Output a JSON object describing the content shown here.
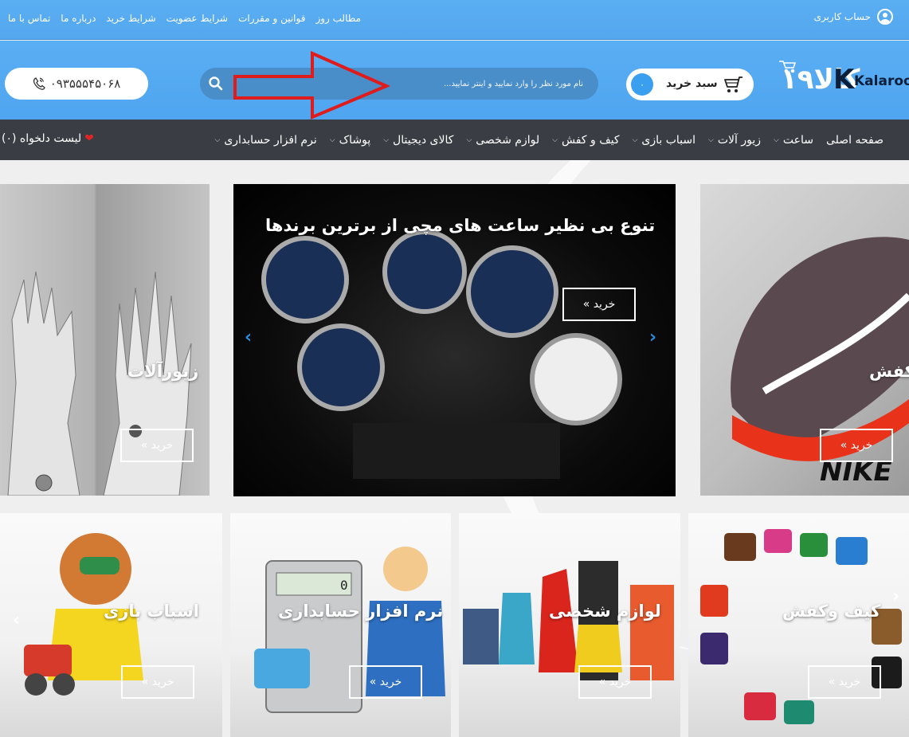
{
  "topbar": {
    "links": [
      "تماس با ما",
      "درباره ما",
      "شرایط خرید",
      "شرایط عضویت",
      "قوانین و مقررات",
      "مطالب روز"
    ],
    "account_label": "حساب کاربری"
  },
  "header": {
    "logo_text": "Kalarooz",
    "cart_label": "سبد خرید",
    "cart_count": "۰",
    "search_placeholder": "نام مورد نظر را وارد نمایید و اینتر نمایید...",
    "phone": "۰۹۳۵۵۵۴۵۰۶۸"
  },
  "nav": {
    "items": [
      {
        "label": "صفحه اصلی",
        "dropdown": false
      },
      {
        "label": "ساعت",
        "dropdown": true
      },
      {
        "label": "زیور آلات",
        "dropdown": true
      },
      {
        "label": "اسباب بازی",
        "dropdown": true
      },
      {
        "label": "کیف و کفش",
        "dropdown": true
      },
      {
        "label": "لوازم شخصی",
        "dropdown": true
      },
      {
        "label": "کالای دیجیتال",
        "dropdown": true
      },
      {
        "label": "پوشاک",
        "dropdown": true
      },
      {
        "label": "نرم افزار حسابداری",
        "dropdown": true
      }
    ],
    "wishlist_label": "لیست دلخواه (۰)"
  },
  "tiles": {
    "jewelry": {
      "title": "زیورآلات",
      "buy": "خرید »"
    },
    "watch": {
      "title": "تنوع بی نظیر ساعت های مچی از برترین برندها",
      "buy": "خرید »"
    },
    "shoes": {
      "title": "کفش",
      "buy": "خرید »"
    },
    "toys": {
      "title": "اسباب بازی",
      "buy": "خرید »"
    },
    "accounting": {
      "title": "نرم افزار حسابداری",
      "buy": "خرید »"
    },
    "personal": {
      "title": "لوازم شخصی",
      "buy": "خرید »"
    },
    "bags": {
      "title": "کیف وکفش",
      "buy": "خرید »"
    }
  },
  "colors": {
    "header_blue": "#54a7ee",
    "nav_dark": "#3a3d44",
    "cart_badge": "#3b9ff0",
    "heart": "#e02424",
    "arrow_annotation": "#e01b1b"
  }
}
